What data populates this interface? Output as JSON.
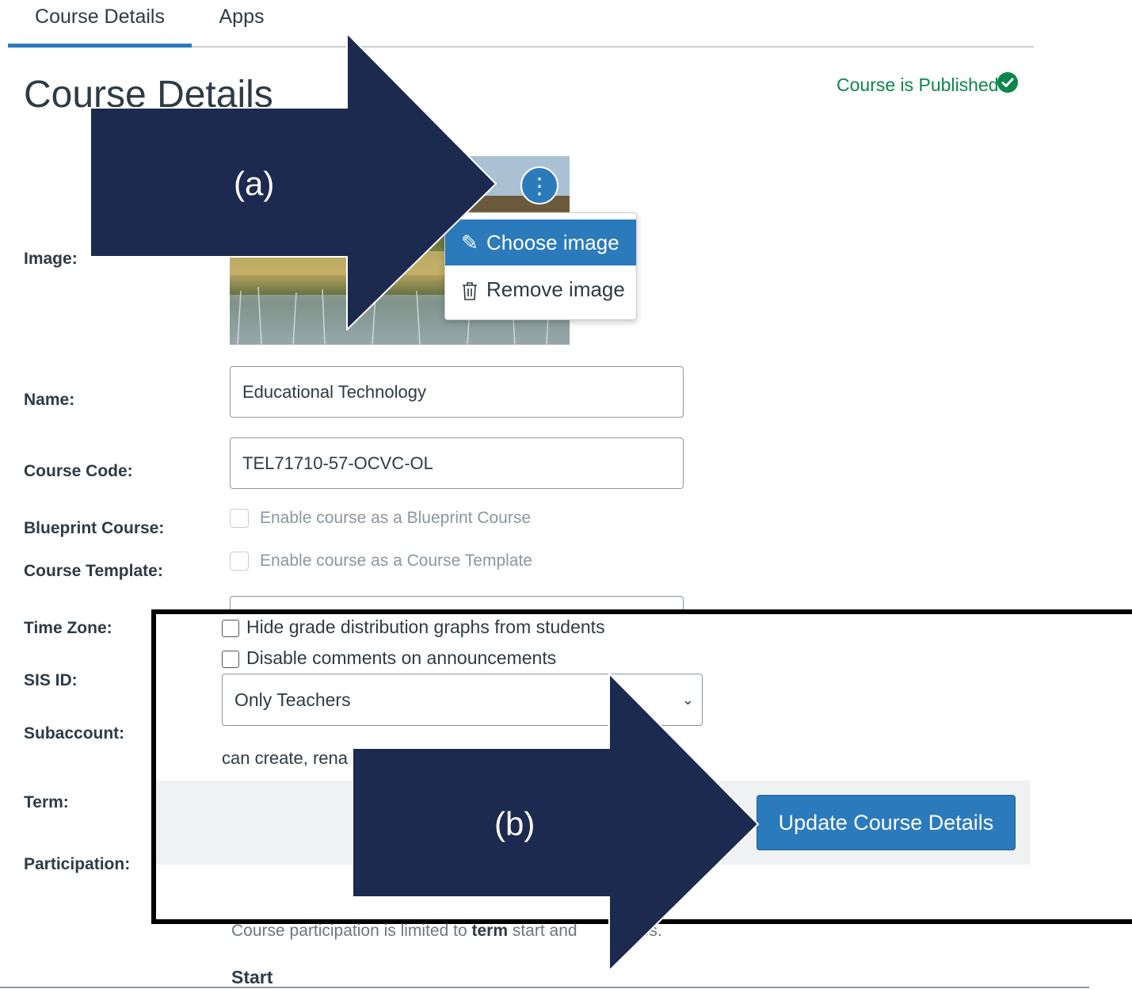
{
  "tabs": [
    {
      "label": "Course Details",
      "active": true
    },
    {
      "label": "Apps",
      "active": false
    }
  ],
  "page_title": "Course Details",
  "status": {
    "text": "Course is Published",
    "icon": "check-circle-icon",
    "color": "#0b874b"
  },
  "image_menu": {
    "items": [
      {
        "label": "Choose image",
        "icon": "pencil-icon",
        "highlighted": true
      },
      {
        "label": "Remove image",
        "icon": "trash-icon",
        "highlighted": false
      }
    ]
  },
  "labels": {
    "image": "Image:",
    "name": "Name:",
    "course_code": "Course Code:",
    "blueprint": "Blueprint Course:",
    "template": "Course Template:",
    "time_zone": "Time Zone:",
    "sis_id": "SIS ID:",
    "subaccount": "Subaccount:",
    "term": "Term:",
    "participation": "Participation:"
  },
  "fields": {
    "name": "Educational Technology",
    "course_code": "TEL71710-57-OCVC-OL"
  },
  "checkboxes": {
    "blueprint": "Enable course as a Blueprint Course",
    "template": "Enable course as a Course Template"
  },
  "options": {
    "hide_grade_distribution": "Hide grade distribution graphs from students",
    "disable_comments": "Disable comments on announcements"
  },
  "select": {
    "value": "Only Teachers"
  },
  "can_create_text": "can create, rena",
  "update_button": "Update Course Details",
  "participation_note": {
    "before": "Course participation is limited to ",
    "bold": "term",
    "after": " start and",
    "tail": "dates."
  },
  "start_label": "Start",
  "annotations": {
    "a": "(a)",
    "b": "(b)"
  },
  "colors": {
    "accent": "#2b7abc",
    "arrow": "#1b2a4e",
    "published": "#0b874b"
  }
}
